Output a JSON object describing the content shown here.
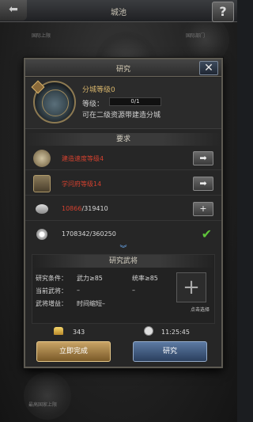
{
  "topbar": {
    "title": "城池",
    "back_icon": "back-arrow-icon",
    "help_label": "?"
  },
  "background": {
    "label_left": "国际上限",
    "label_right": "国际部门",
    "label_bottom": "最高国家上限"
  },
  "modal": {
    "title": "研究",
    "close_label": "✕",
    "building": {
      "name": "分城等级0",
      "level_label": "等级：",
      "level_value": "0/1",
      "description": "可在二级资源带建造分城"
    },
    "requirements": {
      "header": "要求",
      "items": [
        {
          "icon": "construction-speed-icon",
          "text_red": "建造速度等级4",
          "text_white": "",
          "action": "go",
          "action_label": "➡"
        },
        {
          "icon": "academy-building-icon",
          "text_red": "学问府等级14",
          "text_white": "",
          "action": "go",
          "action_label": "➡"
        },
        {
          "icon": "book-resource-icon",
          "text_red": "10866",
          "text_white": "/319410",
          "action": "add",
          "action_label": "+"
        },
        {
          "icon": "coin-resource-icon",
          "text_red": "",
          "text_white": "1708342/360250",
          "action": "done",
          "action_label": "✔"
        }
      ],
      "more_icon": "︾"
    },
    "general": {
      "header": "研究武将",
      "cond_label": "研究条件：",
      "cond_1": "武力≥85",
      "cond_2": "统率≥85",
      "current_label": "当前武将：",
      "current_1": "–",
      "current_2": "–",
      "bonus_label": "武将增益：",
      "bonus_value": "时间缩短–",
      "slot_plus": "+",
      "slot_label": "点击选择"
    },
    "footer": {
      "gold_icon": "gold-ingot-icon",
      "gold_value": "343",
      "time_icon": "hourglass-icon",
      "time_value": "11:25:45",
      "instant_label": "立即完成",
      "research_label": "研究"
    }
  }
}
